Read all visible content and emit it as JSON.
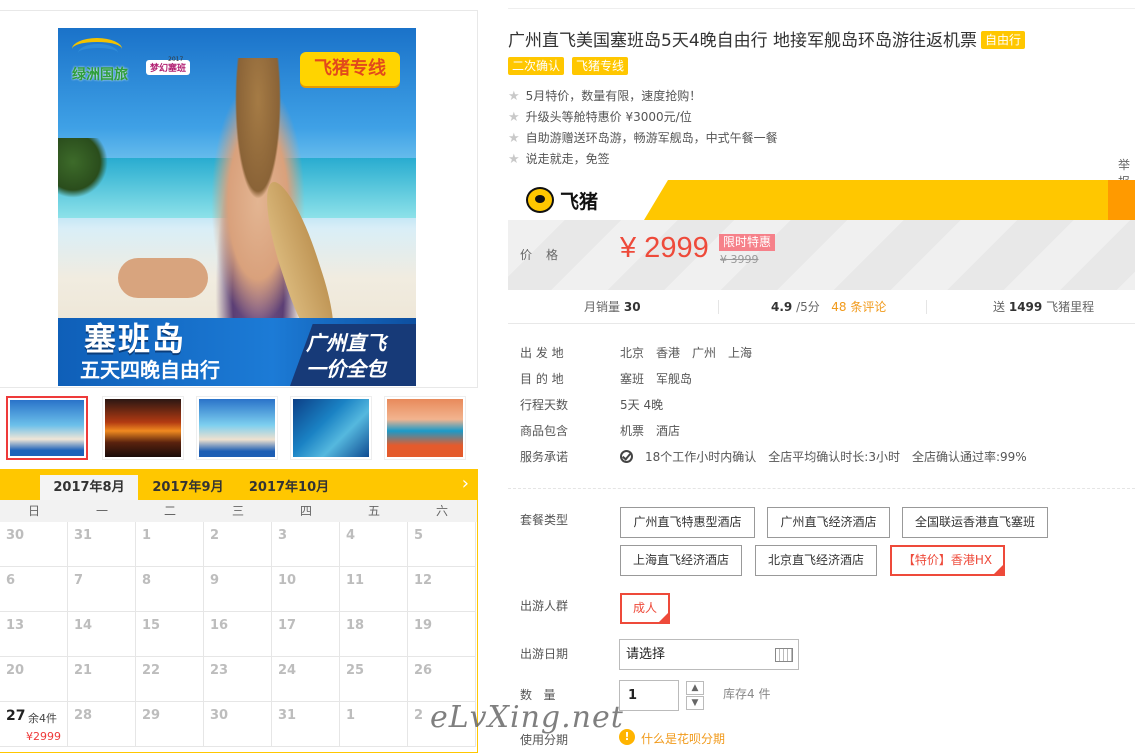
{
  "gallery": {
    "brand_name": "绿洲国旅",
    "brand_tag": "梦幻塞班",
    "brand_year": "2017",
    "ribbon": "飞猪专线",
    "banner_line1": "塞班岛",
    "banner_line2": "五天四晚自由行",
    "banner_right1": "广州直飞",
    "banner_right2": "一价全包"
  },
  "calendar": {
    "tabs": [
      "2017年8月",
      "2017年9月",
      "2017年10月"
    ],
    "next_icon": "›",
    "weekdays": [
      "日",
      "一",
      "二",
      "三",
      "四",
      "五",
      "六"
    ],
    "rows": [
      [
        "30",
        "31",
        "1",
        "2",
        "3",
        "4",
        "5"
      ],
      [
        "6",
        "7",
        "8",
        "9",
        "10",
        "11",
        "12"
      ],
      [
        "13",
        "14",
        "15",
        "16",
        "17",
        "18",
        "19"
      ],
      [
        "20",
        "21",
        "22",
        "23",
        "24",
        "25",
        "26"
      ],
      [
        "27",
        "28",
        "29",
        "30",
        "31",
        "1",
        "2"
      ]
    ],
    "available": {
      "day": "27",
      "stock": "余4件",
      "price": "¥2999"
    }
  },
  "product": {
    "title": "广州直飞美国塞班岛5天4晚自由行 地接军舰岛环岛游往返机票",
    "title_tag": "自由行",
    "tags": [
      "二次确认",
      "飞猪专线"
    ],
    "bullets": [
      "5月特价，数量有限，速度抢购！",
      "升级头等舱特惠价 ¥3000元/位",
      "自助游赠送环岛游，畅游军舰岛，中式午餐一餐",
      "说走就走，免签"
    ],
    "report": "举报"
  },
  "fliggy": {
    "logo_text": "飞猪"
  },
  "price": {
    "label": "价格",
    "value": "¥ 2999",
    "promo": "限时特惠",
    "original": "¥ 3999"
  },
  "stats": {
    "monthly_label": "月销量",
    "monthly_value": "30",
    "rating": "4.9",
    "rating_suffix": "/5分",
    "reviews": "48 条评论",
    "miles_prefix": "送",
    "miles_value": "1499",
    "miles_suffix": "飞猪里程"
  },
  "info": {
    "depart_label": "出 发 地",
    "depart": [
      "北京",
      "香港",
      "广州",
      "上海"
    ],
    "dest_label": "目 的 地",
    "dest": [
      "塞班",
      "军舰岛"
    ],
    "days_label": "行程天数",
    "days": "5天 4晚",
    "includes_label": "商品包含",
    "includes": [
      "机票",
      "酒店"
    ],
    "service_label": "服务承诺",
    "service": [
      "18个工作小时内确认",
      "全店平均确认时长:3小时",
      "全店确认通过率:99%"
    ]
  },
  "options": {
    "package_label": "套餐类型",
    "packages": [
      "广州直飞特惠型酒店",
      "广州直飞经济酒店",
      "全国联运香港直飞塞班",
      "上海直飞经济酒店",
      "北京直飞经济酒店",
      "【特价】香港HX"
    ],
    "people_label": "出游人群",
    "people": "成人",
    "date_label": "出游日期",
    "date_placeholder": "请选择",
    "qty_label": "数   量",
    "qty_value": "1",
    "stock": "库存4 件",
    "installment_label": "使用分期",
    "installment_link": "什么是花呗分期"
  },
  "watermark": "eLvXing.net"
}
